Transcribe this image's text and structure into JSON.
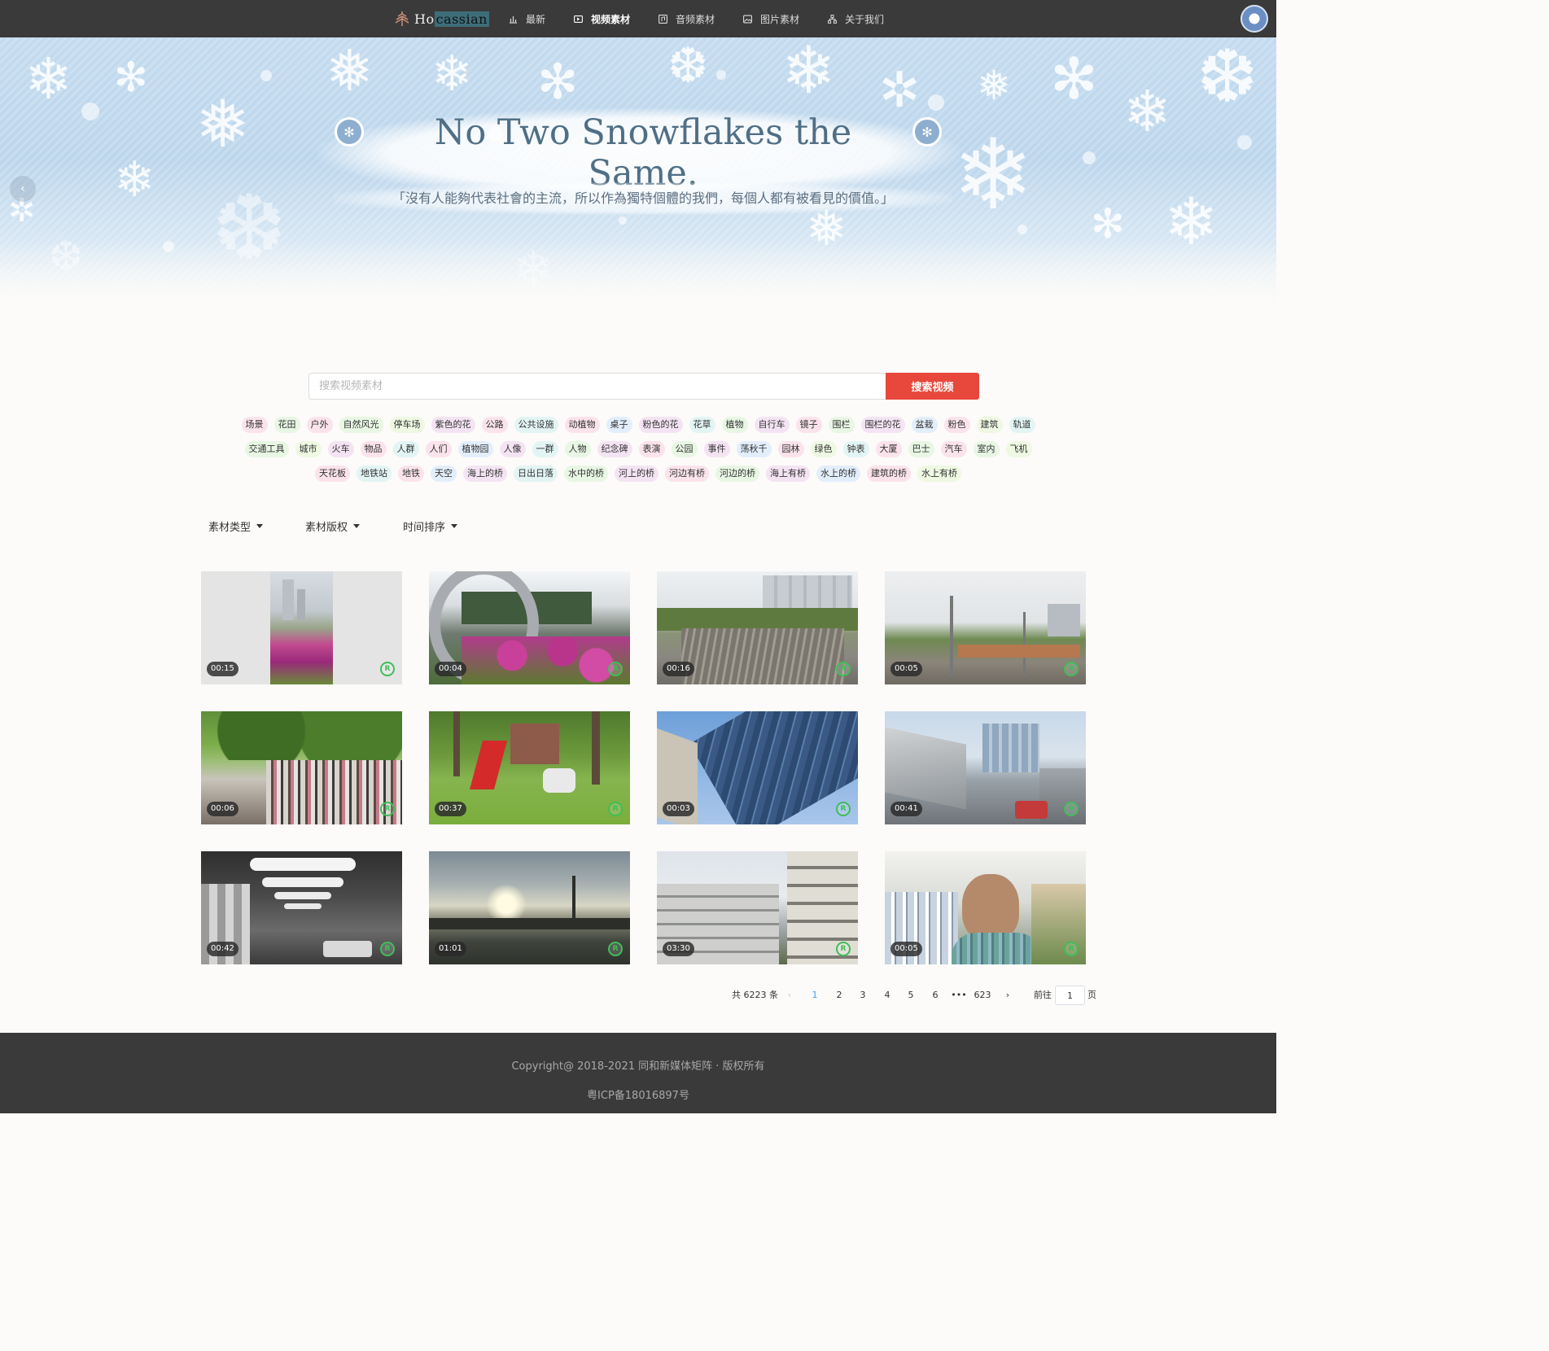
{
  "nav": {
    "brand": {
      "prefix": "Ho",
      "highlight": "cassian"
    },
    "items": [
      {
        "label": "最新",
        "icon": "bar-chart-icon"
      },
      {
        "label": "视频素材",
        "icon": "video-icon",
        "active": true
      },
      {
        "label": "音频素材",
        "icon": "audio-icon"
      },
      {
        "label": "图片素材",
        "icon": "image-icon"
      },
      {
        "label": "关于我们",
        "icon": "org-chart-icon"
      }
    ]
  },
  "banner": {
    "title": "No Two Snowflakes the Same.",
    "subtitle": "「沒有人能夠代表社會的主流，所以作為獨特個體的我們，每個人都有被看見的價值。」"
  },
  "search": {
    "placeholder": "搜索视频素材",
    "button": "搜索视频"
  },
  "tags": {
    "row1": [
      "场景",
      "花田",
      "户外",
      "自然风光",
      "停车场",
      "紫色的花",
      "公路",
      "公共设施",
      "动植物",
      "桌子",
      "粉色的花",
      "花草",
      "植物",
      "自行车",
      "镜子",
      "围栏",
      "围栏的花",
      "盆栽",
      "粉色",
      "建筑",
      "轨道"
    ],
    "row2": [
      "交通工具",
      "城市",
      "火车",
      "物品",
      "人群",
      "人们",
      "植物园",
      "人像",
      "一群",
      "人物",
      "纪念碑",
      "表演",
      "公园",
      "事件",
      "荡秋千",
      "园林",
      "绿色",
      "钟表",
      "大厦",
      "巴士",
      "汽车",
      "室内",
      "飞机"
    ],
    "row3": [
      "天花板",
      "地铁站",
      "地铁",
      "天空",
      "海上的桥",
      "日出日落",
      "水中的桥",
      "河上的桥",
      "河边有桥",
      "河边的桥",
      "海上有桥",
      "水上的桥",
      "建筑的桥",
      "水上有桥"
    ],
    "colors": [
      "#fbe3ec",
      "#e8f6e4",
      "#fbe3ec",
      "#e8f6e4",
      "#eef8e2",
      "#f4e4f3",
      "#fbe3ec",
      "#e3f4f4",
      "#fbe3ec",
      "#e3eefb",
      "#f4e4f3",
      "#e3f4f4",
      "#e8f6e4",
      "#f4e4f3",
      "#fbe3ec",
      "#e8f6e4",
      "#f4e4f3",
      "#e3eefb",
      "#fbe3ec",
      "#eef8e2",
      "#e3f4f4"
    ]
  },
  "filters": [
    {
      "label": "素材类型"
    },
    {
      "label": "素材版权"
    },
    {
      "label": "时间排序"
    }
  ],
  "videos": [
    {
      "duration": "00:15",
      "scene": "flowers-vertical"
    },
    {
      "duration": "00:04",
      "scene": "train-flowers"
    },
    {
      "duration": "00:16",
      "scene": "railyard"
    },
    {
      "duration": "00:05",
      "scene": "railyard-pylons"
    },
    {
      "duration": "00:06",
      "scene": "crowd-park"
    },
    {
      "duration": "00:37",
      "scene": "park-red-flag"
    },
    {
      "duration": "00:03",
      "scene": "glass-tower"
    },
    {
      "duration": "00:41",
      "scene": "overpass"
    },
    {
      "duration": "00:42",
      "scene": "tunnel"
    },
    {
      "duration": "01:01",
      "scene": "bridge-sunset"
    },
    {
      "duration": "03:30",
      "scene": "apartments"
    },
    {
      "duration": "00:05",
      "scene": "portrait"
    }
  ],
  "license_badge": "R",
  "pagination": {
    "total": "共 6223 条",
    "pages": [
      "1",
      "2",
      "3",
      "4",
      "5",
      "6",
      "•••",
      "623"
    ],
    "current": "1",
    "goto_label": "前往",
    "goto_value": "1",
    "page_unit": "页"
  },
  "footer": {
    "copyright": "Copyright@ 2018-2021 同和新媒体矩阵 · 版权所有",
    "icp": "粤ICP备18016897号"
  },
  "colors": {
    "accent": "#e8473b",
    "topbar": "#3a3a3a",
    "license": "#3fbe57",
    "page_active": "#409eff"
  }
}
